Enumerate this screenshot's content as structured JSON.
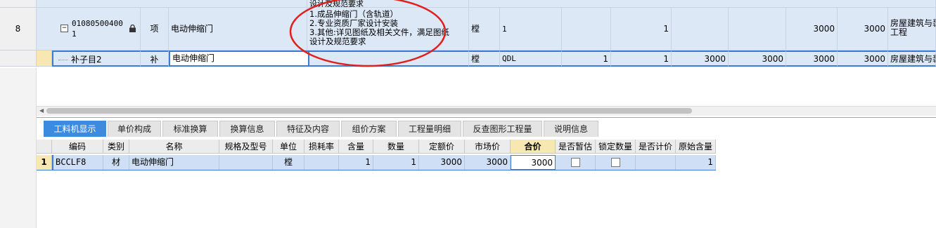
{
  "top_grid": {
    "partial_row_text": "设计及规范要求",
    "row8": {
      "row_no": "8",
      "expand_icon": "minus-box",
      "code_line1": "01080500400",
      "code_line2": "1",
      "lock_icon": "lock",
      "type": "项",
      "name": "电动伸缩门",
      "desc_lines": [
        "1.成品伸缩门（含轨道）",
        "2.专业资质厂家设计安装",
        "3.其他:详见图纸及相关文件，满足图纸",
        "设计及规范要求"
      ],
      "unit": "樘",
      "quantity_expr": "1",
      "quantity": "1",
      "price": "3000",
      "total": "3000",
      "category": "房屋建筑与装",
      "category_line2": "工程"
    },
    "row9": {
      "code": "补子目2",
      "type": "补",
      "name": "电动伸缩门",
      "desc": "",
      "unit": "樘",
      "quantity_expr": "QDL",
      "content": "1",
      "quantity": "1",
      "price_a": "3000",
      "price_b": "3000",
      "price_c": "3000",
      "total": "3000",
      "category": "房屋建筑与装"
    },
    "annotation_color": "#e0201c"
  },
  "tabs": [
    {
      "label": "工料机显示",
      "active": true
    },
    {
      "label": "单价构成"
    },
    {
      "label": "标准换算"
    },
    {
      "label": "换算信息"
    },
    {
      "label": "特征及内容"
    },
    {
      "label": "组价方案"
    },
    {
      "label": "工程量明细"
    },
    {
      "label": "反查图形工程量"
    },
    {
      "label": "说明信息"
    }
  ],
  "lower_grid": {
    "headers": [
      "编码",
      "类别",
      "名称",
      "规格及型号",
      "单位",
      "损耗率",
      "含量",
      "数量",
      "定额价",
      "市场价",
      "合价",
      "是否暂估",
      "锁定数量",
      "是否计价",
      "原始含量"
    ],
    "row": {
      "row_no": "1",
      "code": "BCCLF8",
      "category": "材",
      "name": "电动伸缩门",
      "spec": "",
      "unit": "樘",
      "loss_rate": "",
      "content": "1",
      "quantity": "1",
      "quota_price": "3000",
      "market_price": "3000",
      "total_price": "3000",
      "is_estimate": false,
      "lock_quantity": false,
      "is_priced": "",
      "original_content": "1"
    }
  },
  "colors": {
    "active_tab": "#3d8be0",
    "selected_row": "#dde8f7",
    "highlight_header": "#f7e7b0"
  }
}
